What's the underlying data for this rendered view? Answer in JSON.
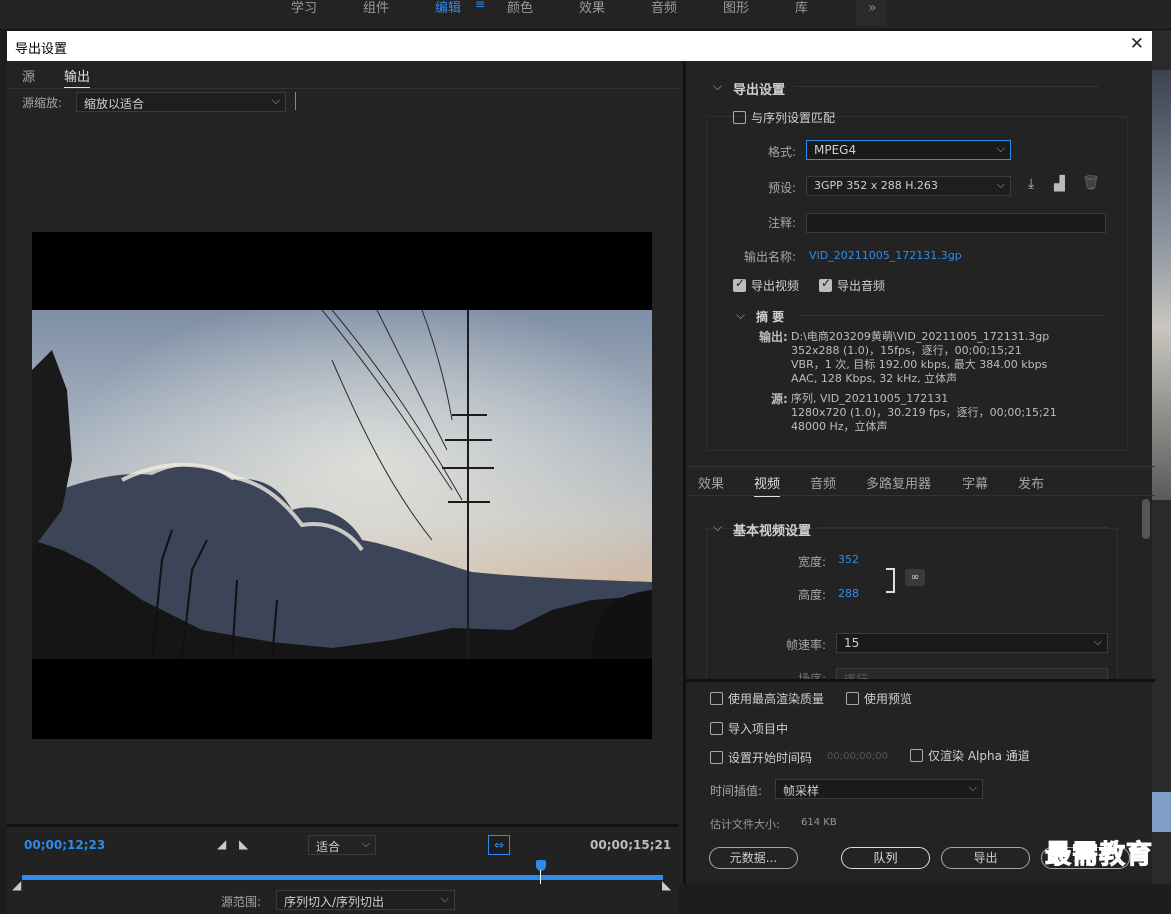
{
  "workspace": {
    "tabs": [
      "学习",
      "组件",
      "编辑",
      "颜色",
      "效果",
      "音频",
      "图形",
      "库"
    ],
    "active": "编辑",
    "menu_icon": "hamburger-icon",
    "overflow_icon": "double-chevron-icon"
  },
  "dialog": {
    "title": "导出设置",
    "close_icon": "close-icon"
  },
  "left": {
    "tabs": [
      "源",
      "输出"
    ],
    "active_tab": "输出",
    "source_scale_label": "源缩放:",
    "source_scale_value": "缩放以适合",
    "timecode_in": "00;00;12;23",
    "timecode_out": "00;00;15;21",
    "zoom_value": "适合",
    "source_range_label": "源范围:",
    "source_range_value": "序列切入/序列切出",
    "playhead_fraction": 0.81
  },
  "export_settings": {
    "section_title": "导出设置",
    "match_sequence_label": "与序列设置匹配",
    "match_sequence_checked": false,
    "format_label": "格式:",
    "format_value": "MPEG4",
    "preset_label": "预设:",
    "preset_value": "3GPP 352 x 288 H.263",
    "comment_label": "注释:",
    "comment_value": "",
    "output_name_label": "输出名称:",
    "output_name_value": "VID_20211005_172131.3gp",
    "export_video_label": "导出视频",
    "export_video_checked": true,
    "export_audio_label": "导出音频",
    "export_audio_checked": true,
    "summary_title": "摘 要",
    "output_label": "输出:",
    "output_lines": [
      "D:\\电商203209黄萌\\VID_20211005_172131.3gp",
      "352x288 (1.0)，15fps，逐行，00;00;15;21",
      "VBR，1 次, 目标 192.00 kbps, 最大 384.00 kbps",
      "AAC, 128 Kbps, 32  kHz, 立体声"
    ],
    "source_label": "源:",
    "source_lines": [
      "序列, VID_20211005_172131",
      "1280x720 (1.0)，30.219 fps，逐行，00;00;15;21",
      "48000 Hz，立体声"
    ]
  },
  "settings_tabs": {
    "tabs": [
      "效果",
      "视频",
      "音频",
      "多路复用器",
      "字幕",
      "发布"
    ],
    "active": "视频"
  },
  "video": {
    "section_title": "基本视频设置",
    "width_label": "宽度:",
    "width_value": "352",
    "height_label": "高度:",
    "height_value": "288",
    "frame_rate_label": "帧速率:",
    "frame_rate_value": "15",
    "field_order_label": "场序:",
    "field_order_value": "逐行"
  },
  "bottom": {
    "max_render_label": "使用最高渲染质量",
    "use_previews_label": "使用预览",
    "import_project_label": "导入项目中",
    "set_timecode_label": "设置开始时间码",
    "timecode_value": "00;00;00;00",
    "alpha_only_label": "仅渲染 Alpha 通道",
    "interp_label": "时间插值:",
    "interp_value": "帧采样",
    "filesize_label": "估计文件大小:",
    "filesize_value": "614 KB",
    "metadata_button": "元数据...",
    "queue_button": "队列",
    "export_button": "导出",
    "cancel_button": "取消"
  },
  "watermark": "最需教育",
  "colors": {
    "accent": "#2d8ceb",
    "panel": "#232323"
  }
}
